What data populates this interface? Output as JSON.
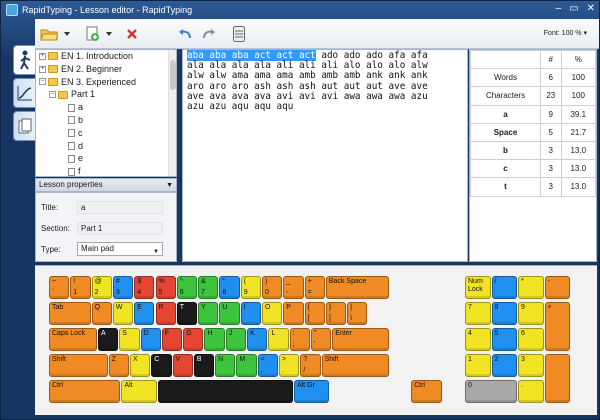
{
  "window": {
    "title": "RapidTyping - Lesson editor - RapidTyping",
    "controls": [
      "–",
      "▭",
      "✕"
    ]
  },
  "toolbar": {
    "font_label": "Font: 100 %"
  },
  "tree": {
    "items": [
      {
        "label": "EN 1. Introduction",
        "level": 0,
        "expander": "+",
        "kind": "folder"
      },
      {
        "label": "EN 2. Beginner",
        "level": 0,
        "expander": "+",
        "kind": "folder"
      },
      {
        "label": "EN 3. Experienced",
        "level": 0,
        "expander": "−",
        "kind": "folder"
      },
      {
        "label": "Part 1",
        "level": 1,
        "expander": "−",
        "kind": "folder"
      },
      {
        "label": "a",
        "level": 2,
        "expander": "",
        "kind": "page"
      },
      {
        "label": "b",
        "level": 2,
        "expander": "",
        "kind": "page"
      },
      {
        "label": "c",
        "level": 2,
        "expander": "",
        "kind": "page"
      },
      {
        "label": "d",
        "level": 2,
        "expander": "",
        "kind": "page"
      },
      {
        "label": "e",
        "level": 2,
        "expander": "",
        "kind": "page"
      },
      {
        "label": "f",
        "level": 2,
        "expander": "",
        "kind": "page"
      }
    ]
  },
  "props": {
    "header": "Lesson properties",
    "title_label": "Title:",
    "title_value": "a",
    "section_label": "Section:",
    "section_value": "Part 1",
    "type_label": "Type:",
    "type_value": "Main pad"
  },
  "editor": {
    "selected": "aba aba aba act act act",
    "first_rest": " ado ado ado afa afa",
    "lines": [
      "ala ala ala ala ali ali ali alo alo alo alw",
      "alw alw ama ama ama amb amb amb ank ank ank",
      "aro aro aro ash ash ash aut aut aut ave ave",
      "ave ava ava ava avi avi avi awa awa awa azu",
      "azu azu aqu aqu aqu"
    ]
  },
  "stats": {
    "headers": [
      "",
      "#",
      "%"
    ],
    "rows": [
      {
        "label": "Words",
        "count": "6",
        "pct": "100",
        "bold": false
      },
      {
        "label": "Characters",
        "count": "23",
        "pct": "100",
        "bold": false
      },
      {
        "label": "a",
        "count": "9",
        "pct": "39.1",
        "bold": true
      },
      {
        "label": "Space",
        "count": "5",
        "pct": "21.7",
        "bold": true
      },
      {
        "label": "b",
        "count": "3",
        "pct": "13.0",
        "bold": true
      },
      {
        "label": "c",
        "count": "3",
        "pct": "13.0",
        "bold": true
      },
      {
        "label": "t",
        "count": "3",
        "pct": "13.0",
        "bold": true
      }
    ]
  },
  "keyboard": {
    "keys": [
      {
        "t": "~",
        "b": "`",
        "c": "orange"
      },
      {
        "t": "!",
        "b": "1",
        "c": "orange"
      },
      {
        "t": "@",
        "b": "2",
        "c": "yellow"
      },
      {
        "t": "#",
        "b": "3",
        "c": "blue"
      },
      {
        "t": "$",
        "b": "4",
        "c": "red"
      },
      {
        "t": "%",
        "b": "5",
        "c": "red"
      },
      {
        "t": "^",
        "b": "6",
        "c": "green"
      },
      {
        "t": "&",
        "b": "7",
        "c": "green"
      },
      {
        "t": "*",
        "b": "8",
        "c": "blue"
      },
      {
        "t": "(",
        "b": "9",
        "c": "yellow"
      },
      {
        "t": ")",
        "b": "0",
        "c": "orange"
      },
      {
        "t": "_",
        "b": "-",
        "c": "orange"
      },
      {
        "t": "+",
        "b": "=",
        "c": "orange"
      },
      {
        "t": "Back Space",
        "b": "",
        "c": "orange"
      },
      {
        "t": "Tab",
        "b": "",
        "c": "orange"
      },
      {
        "t": "Q",
        "b": "",
        "c": "orange"
      },
      {
        "t": "W",
        "b": "",
        "c": "yellow"
      },
      {
        "t": "E",
        "b": "",
        "c": "blue"
      },
      {
        "t": "R",
        "b": "",
        "c": "red"
      },
      {
        "t": "T",
        "b": "",
        "c": "black"
      },
      {
        "t": "Y",
        "b": "",
        "c": "green"
      },
      {
        "t": "U",
        "b": "",
        "c": "green"
      },
      {
        "t": "I",
        "b": "",
        "c": "blue"
      },
      {
        "t": "O",
        "b": "",
        "c": "yellow"
      },
      {
        "t": "P",
        "b": "",
        "c": "orange"
      },
      {
        "t": "{",
        "b": "[",
        "c": "orange"
      },
      {
        "t": "}",
        "b": "]",
        "c": "orange"
      },
      {
        "t": "|",
        "b": "\\",
        "c": "orange"
      },
      {
        "t": "Caps Lock",
        "b": "",
        "c": "orange"
      },
      {
        "t": "A",
        "b": "",
        "c": "black"
      },
      {
        "t": "S",
        "b": "",
        "c": "yellow"
      },
      {
        "t": "D",
        "b": "",
        "c": "blue"
      },
      {
        "t": "F",
        "b": "",
        "c": "red"
      },
      {
        "t": "G",
        "b": "",
        "c": "red"
      },
      {
        "t": "H",
        "b": "",
        "c": "green"
      },
      {
        "t": "J",
        "b": "",
        "c": "green"
      },
      {
        "t": "K",
        "b": "",
        "c": "blue"
      },
      {
        "t": "L",
        "b": "",
        "c": "yellow"
      },
      {
        "t": ":",
        "b": ";",
        "c": "orange"
      },
      {
        "t": "\"",
        "b": "'",
        "c": "orange"
      },
      {
        "t": "Enter",
        "b": "",
        "c": "orange"
      },
      {
        "t": "Shift",
        "b": "",
        "c": "orange"
      },
      {
        "t": "Z",
        "b": "",
        "c": "orange"
      },
      {
        "t": "X",
        "b": "",
        "c": "yellow"
      },
      {
        "t": "C",
        "b": "",
        "c": "black"
      },
      {
        "t": "V",
        "b": "",
        "c": "red"
      },
      {
        "t": "B",
        "b": "",
        "c": "black"
      },
      {
        "t": "N",
        "b": "",
        "c": "green"
      },
      {
        "t": "M",
        "b": "",
        "c": "green"
      },
      {
        "t": "<",
        "b": ",",
        "c": "blue"
      },
      {
        "t": ">",
        "b": ".",
        "c": "yellow"
      },
      {
        "t": "?",
        "b": "/",
        "c": "orange"
      },
      {
        "t": "Shift",
        "b": "",
        "c": "orange"
      },
      {
        "t": "Ctrl",
        "b": "",
        "c": "orange"
      },
      {
        "t": "Alt",
        "b": "",
        "c": "yellow"
      },
      {
        "t": "",
        "b": "",
        "c": "black"
      },
      {
        "t": "Alt Gr",
        "b": "",
        "c": "blue"
      },
      {
        "t": "Ctrl",
        "b": "",
        "c": "orange"
      },
      {
        "t": "Num Lock",
        "b": "",
        "c": "yellow"
      },
      {
        "t": "/",
        "b": "",
        "c": "blue"
      },
      {
        "t": "*",
        "b": "",
        "c": "yellow"
      },
      {
        "t": "-",
        "b": "",
        "c": "orange"
      },
      {
        "t": "7",
        "b": "",
        "c": "yellow"
      },
      {
        "t": "8",
        "b": "",
        "c": "blue"
      },
      {
        "t": "9",
        "b": "",
        "c": "yellow"
      },
      {
        "t": "+",
        "b": "",
        "c": "orange"
      },
      {
        "t": "4",
        "b": "",
        "c": "yellow"
      },
      {
        "t": "5",
        "b": "",
        "c": "blue"
      },
      {
        "t": "6",
        "b": "",
        "c": "yellow"
      },
      {
        "t": "1",
        "b": "",
        "c": "yellow"
      },
      {
        "t": "2",
        "b": "",
        "c": "blue"
      },
      {
        "t": "3",
        "b": "",
        "c": "yellow"
      },
      {
        "t": "",
        "b": "",
        "c": "orange"
      },
      {
        "t": "0",
        "b": "",
        "c": "grey"
      },
      {
        "t": ".",
        "b": "",
        "c": "yellow"
      }
    ]
  }
}
